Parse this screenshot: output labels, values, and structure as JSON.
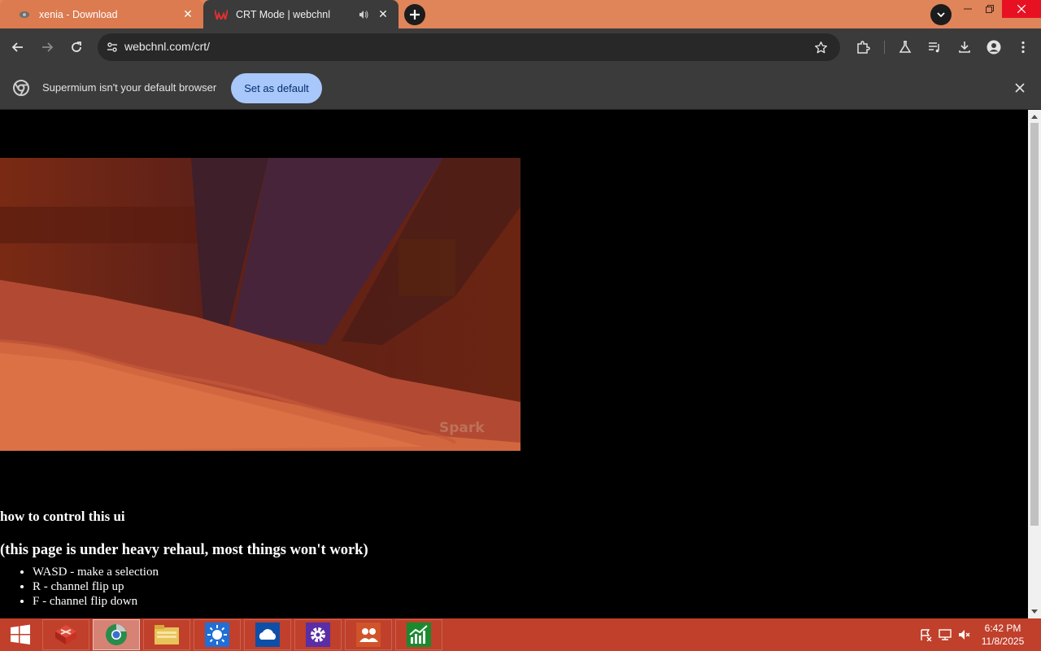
{
  "browser": {
    "tabs": [
      {
        "title": "xenia - Download",
        "active": false
      },
      {
        "title": "CRT Mode | webchnl",
        "active": true
      }
    ],
    "address_bar": {
      "url": "webchnl.com/crt/"
    },
    "infobar": {
      "message": "Supermium isn't your default browser",
      "button_label": "Set as default"
    }
  },
  "page": {
    "video_watermark": "Spark",
    "heading": "how to control this ui",
    "subheading": "(this page is under heavy rehaul, most things won't work)",
    "controls": [
      "WASD - make a selection",
      "R - channel flip up",
      "F - channel flip down"
    ]
  },
  "taskbar": {
    "apps": [
      "app-red-cube",
      "supermium-browser",
      "file-explorer",
      "weather",
      "onedrive",
      "settings",
      "people",
      "finance"
    ],
    "active_app": "supermium-browser",
    "clock": {
      "time": "6:42 PM",
      "date": "11/8/2025"
    }
  },
  "colors": {
    "tabstrip": "#e0845a",
    "toolbar": "#3b3b3b",
    "taskbar": "#c0402b",
    "accent_button": "#a8c7fa"
  }
}
